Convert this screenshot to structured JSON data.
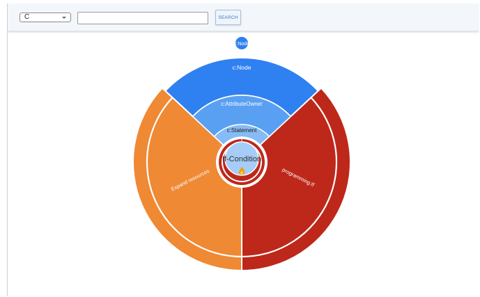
{
  "toolbar": {
    "select_value": "C",
    "search_value": "",
    "search_label": "SEARCH"
  },
  "sunburst": {
    "top_node_label": "c:Node",
    "ring_node_label": "c:Node",
    "attribute_owner_label": "c:AttributeOwner",
    "statement_label": "c:Statement",
    "center_label": "If-Condition",
    "center_icon": "fire-icon",
    "left_segment_label": "Expand resources",
    "right_segment_label": "programming:If",
    "colors": {
      "node": "#2f80f0",
      "attribute_owner": "#5aa0f2",
      "statement": "#86bbf5",
      "center": "#a6cdf7",
      "expand": "#ef8934",
      "programming": "#bd281b"
    }
  }
}
